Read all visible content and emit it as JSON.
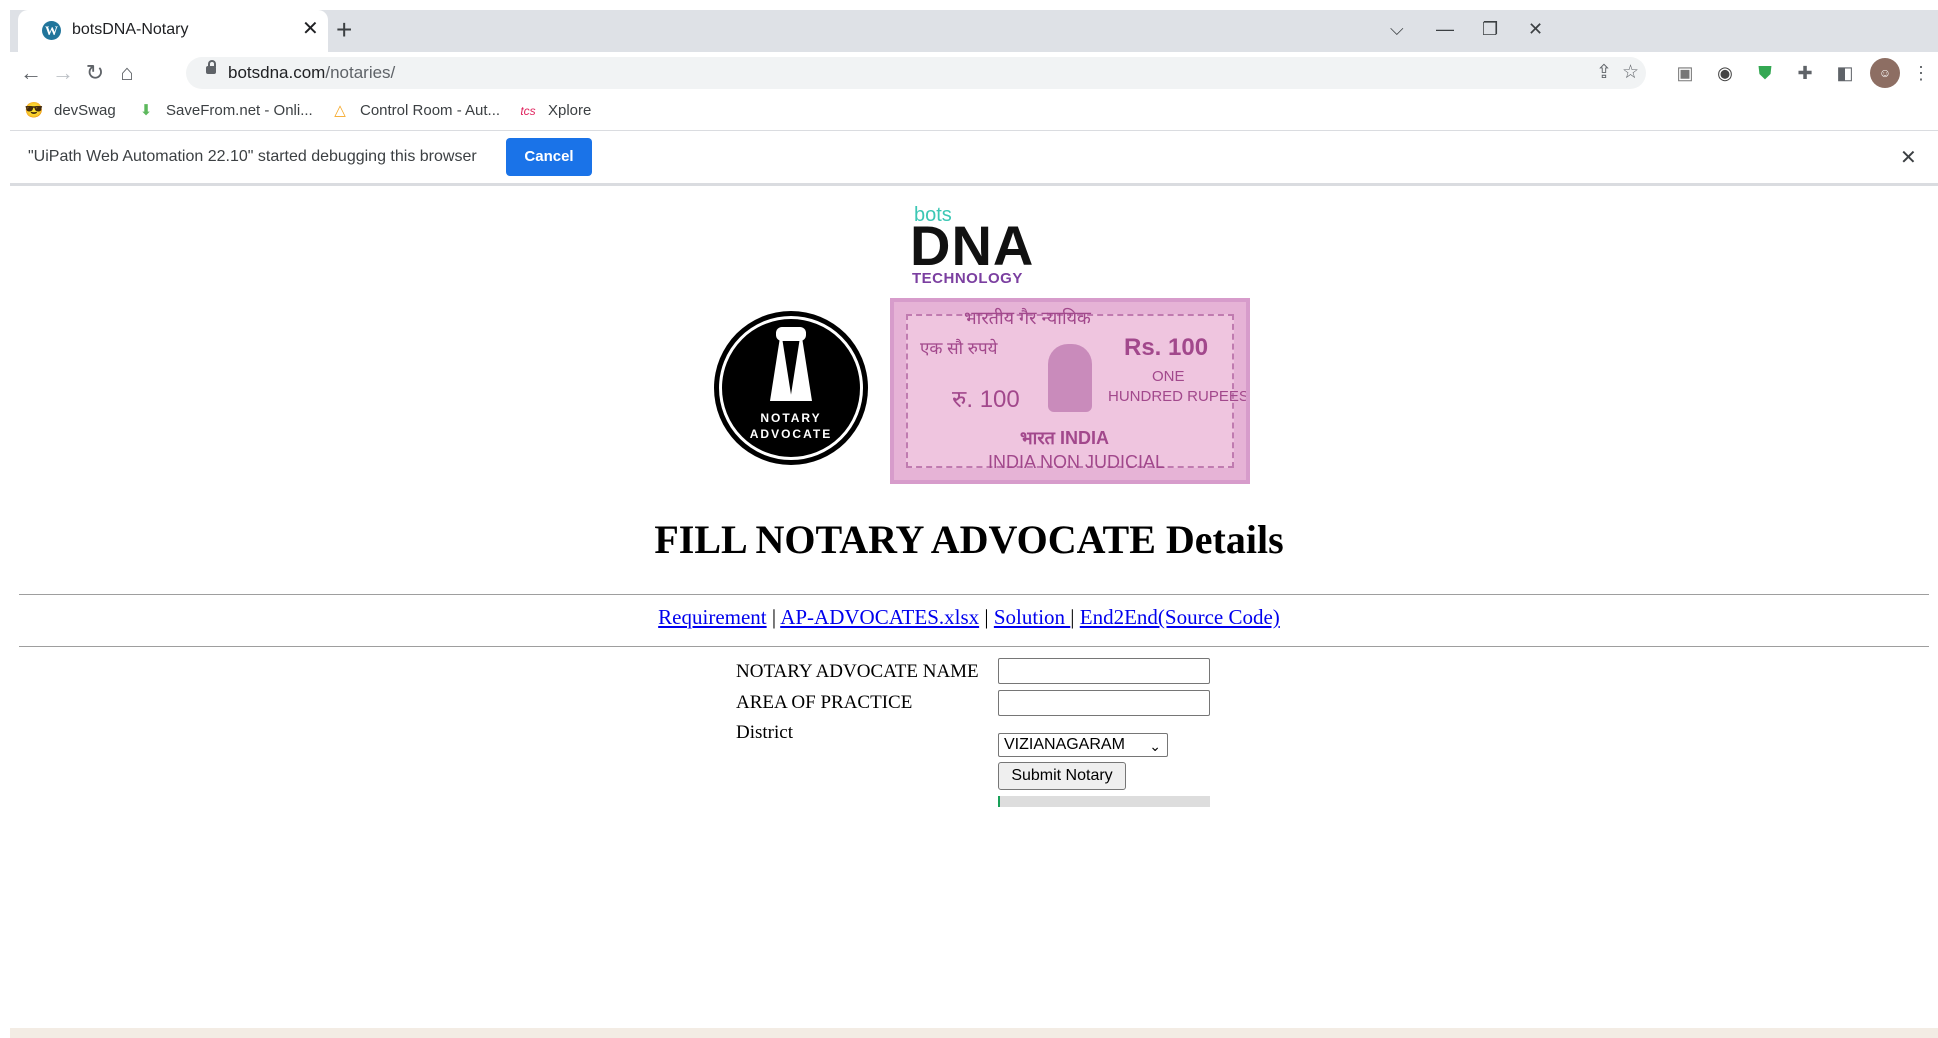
{
  "browser": {
    "tab_title": "botsDNA-Notary",
    "tab_close": "✕",
    "new_tab": "+",
    "url_host": "botsdna.com",
    "url_path": "/notaries/",
    "window_buttons": {
      "tabsearch": "⌵",
      "minimize": "—",
      "restore": "❐",
      "close": "✕"
    },
    "bookmarks": [
      {
        "label": "devSwag",
        "icon": "😎",
        "icon_name": "sunglasses-emoji-icon"
      },
      {
        "label": "SaveFrom.net - Onli...",
        "icon": "⬇",
        "icon_name": "green-download-icon",
        "color": "#5cb85c"
      },
      {
        "label": "Control Room - Aut...",
        "icon": "△",
        "icon_name": "automation-anywhere-icon",
        "color": "#f5a623"
      },
      {
        "label": "Xplore",
        "icon": "tcs",
        "icon_name": "tcs-icon",
        "color": "#e0245e"
      }
    ],
    "infobar": {
      "message": "\"UiPath Web Automation 22.10\" started debugging this browser",
      "cancel_label": "Cancel",
      "close": "✕"
    }
  },
  "page": {
    "logo": {
      "bots": "bots",
      "dna": "DNA",
      "tech": "TECHNOLOGY"
    },
    "seal": {
      "line1": "NOTARY",
      "line2": "ADVOCATE"
    },
    "stamp": {
      "hindi_top": "भारतीय गैर न्यायिक",
      "ek_sau": "एक सौ रुपये",
      "rs": "Rs. 100",
      "ru": "रु. 100",
      "one": "ONE",
      "hundred": "HUNDRED RUPEES",
      "bharat": "भारत INDIA",
      "nonjudicial": "INDIA NON JUDICIAL"
    },
    "heading": "FILL NOTARY ADVOCATE Details",
    "links": {
      "requirement": "Requirement",
      "sep": "|",
      "xlsx": "AP-ADVOCATES.xlsx",
      "solution": "Solution ",
      "end2end": "End2End(Source Code)"
    },
    "form": {
      "name_label": "NOTARY ADVOCATE NAME",
      "name_value": "",
      "area_label": "AREA OF PRACTICE",
      "area_value": "",
      "district_label": "District",
      "district_selected": "VIZIANAGARAM",
      "submit_label": "Submit Notary",
      "progress_fraction": 0.01,
      "progress_color": "#18a058"
    }
  }
}
